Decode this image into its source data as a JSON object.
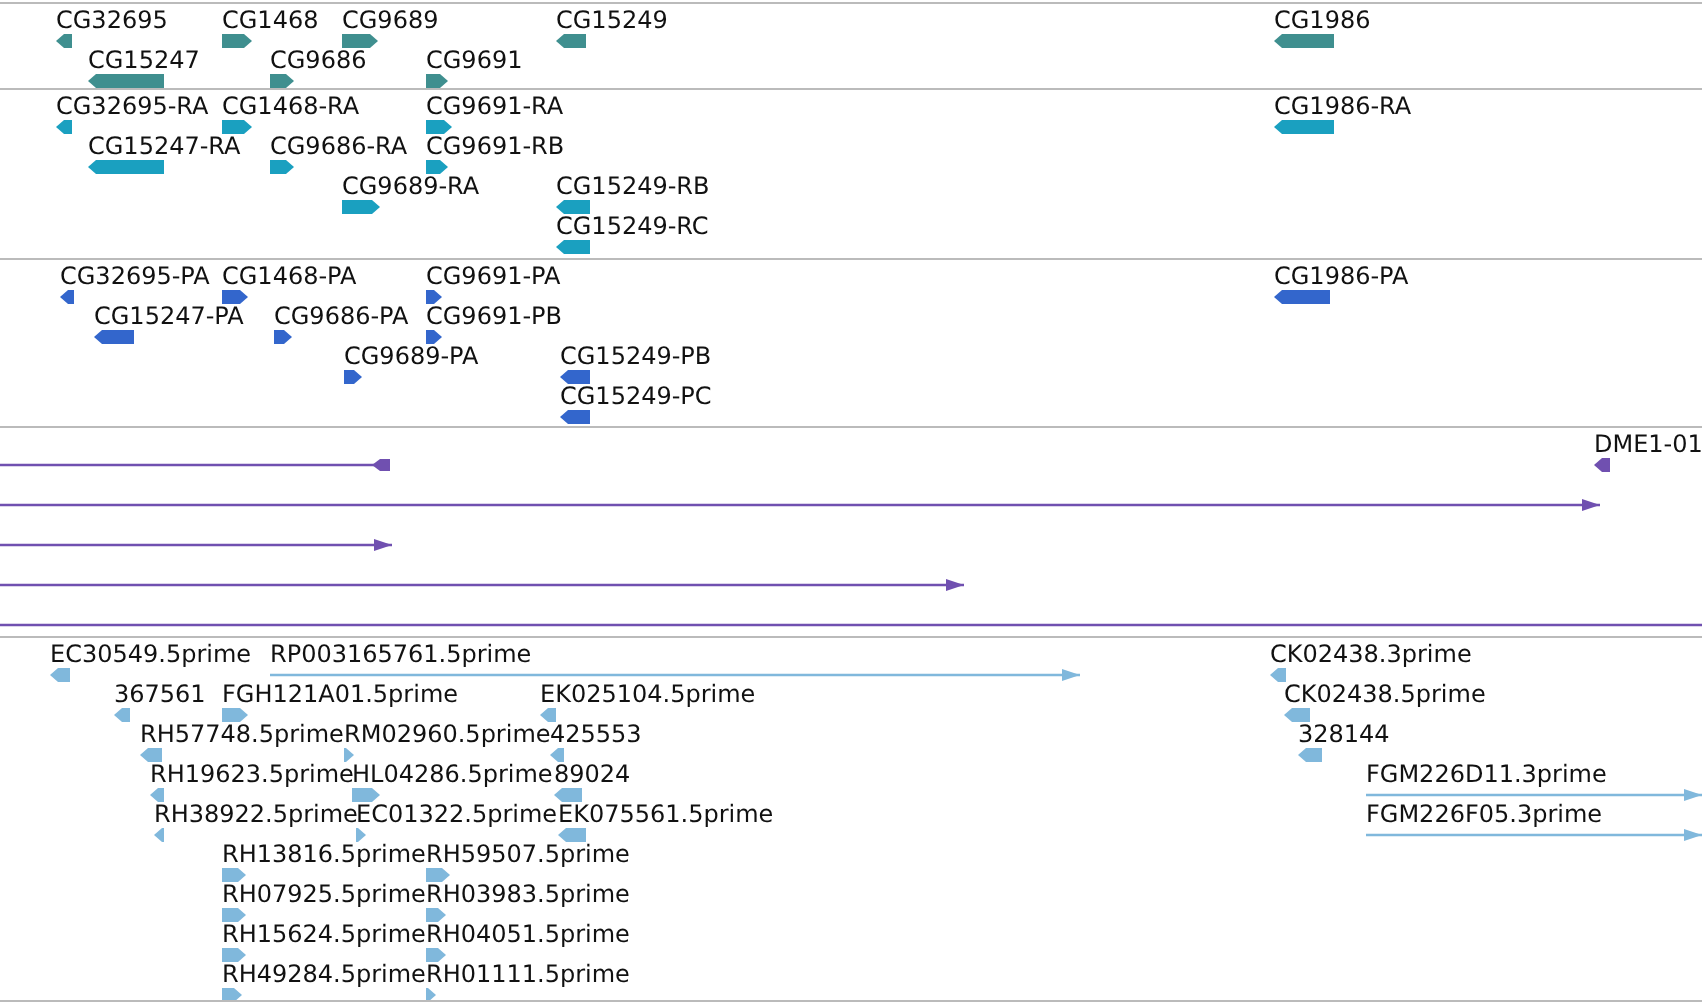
{
  "tracks": [
    {
      "color": "#3f8f8f",
      "features": [
        {
          "label": "CG32695",
          "reverse": true,
          "kind": "block"
        },
        {
          "label": "CG1468",
          "reverse": false,
          "kind": "block"
        },
        {
          "label": "CG9689",
          "reverse": false,
          "kind": "block"
        },
        {
          "label": "CG15249",
          "reverse": true,
          "kind": "block"
        },
        {
          "label": "CG1986",
          "reverse": true,
          "kind": "block"
        },
        {
          "label": "CG15247",
          "reverse": true,
          "kind": "block"
        },
        {
          "label": "CG9686",
          "reverse": false,
          "kind": "block"
        },
        {
          "label": "CG9691",
          "reverse": false,
          "kind": "block"
        }
      ]
    },
    {
      "color": "#1aa0c0",
      "features": [
        {
          "label": "CG32695-RA",
          "reverse": true,
          "kind": "block"
        },
        {
          "label": "CG1468-RA",
          "reverse": false,
          "kind": "block"
        },
        {
          "label": "CG9691-RA",
          "reverse": false,
          "kind": "block"
        },
        {
          "label": "CG1986-RA",
          "reverse": true,
          "kind": "block"
        },
        {
          "label": "CG15247-RA",
          "reverse": true,
          "kind": "block"
        },
        {
          "label": "CG9686-RA",
          "reverse": false,
          "kind": "block"
        },
        {
          "label": "CG9691-RB",
          "reverse": false,
          "kind": "block"
        },
        {
          "label": "CG9689-RA",
          "reverse": false,
          "kind": "block"
        },
        {
          "label": "CG15249-RB",
          "reverse": true,
          "kind": "block"
        },
        {
          "label": "CG15249-RC",
          "reverse": true,
          "kind": "block"
        }
      ]
    },
    {
      "color": "#3366cc",
      "features": [
        {
          "label": "CG32695-PA",
          "reverse": true,
          "kind": "block"
        },
        {
          "label": "CG1468-PA",
          "reverse": false,
          "kind": "block"
        },
        {
          "label": "CG9691-PA",
          "reverse": false,
          "kind": "block"
        },
        {
          "label": "CG1986-PA",
          "reverse": true,
          "kind": "block"
        },
        {
          "label": "CG15247-PA",
          "reverse": true,
          "kind": "block"
        },
        {
          "label": "CG9686-PA",
          "reverse": false,
          "kind": "block"
        },
        {
          "label": "CG9691-PB",
          "reverse": false,
          "kind": "block"
        },
        {
          "label": "CG9689-PA",
          "reverse": false,
          "kind": "block"
        },
        {
          "label": "CG15249-PB",
          "reverse": true,
          "kind": "block"
        },
        {
          "label": "CG15249-PC",
          "reverse": true,
          "kind": "block"
        }
      ]
    },
    {
      "color": "#7050b0",
      "features": [
        {
          "reverse": true,
          "kind": "arrowline"
        },
        {
          "label": "DME1-01",
          "reverse": true,
          "kind": "block"
        },
        {
          "reverse": false,
          "kind": "arrowline"
        },
        {
          "reverse": false,
          "kind": "arrowline"
        },
        {
          "reverse": false,
          "kind": "arrowline"
        },
        {
          "kind": "plainline"
        }
      ]
    },
    {
      "color": "#80b8dc",
      "features": [
        {
          "label": "EC30549.5prime",
          "reverse": true,
          "kind": "block"
        },
        {
          "label": "RP003165761.5prime",
          "reverse": false,
          "kind": "arrowline"
        },
        {
          "label": "CK02438.3prime",
          "reverse": true,
          "kind": "block"
        },
        {
          "label": "367561",
          "reverse": true,
          "kind": "block"
        },
        {
          "label": "FGH121A01.5prime",
          "reverse": false,
          "kind": "block"
        },
        {
          "label": "EK025104.5prime",
          "reverse": true,
          "kind": "block"
        },
        {
          "label": "CK02438.5prime",
          "reverse": true,
          "kind": "block"
        },
        {
          "label": "RH57748.5prime",
          "reverse": true,
          "kind": "block"
        },
        {
          "label": "RM02960.5prime",
          "reverse": false,
          "kind": "block"
        },
        {
          "label": "425553",
          "reverse": true,
          "kind": "block"
        },
        {
          "label": "328144",
          "reverse": true,
          "kind": "block"
        },
        {
          "label": "RH19623.5prime",
          "reverse": true,
          "kind": "block"
        },
        {
          "label": "HL04286.5prime",
          "reverse": false,
          "kind": "block"
        },
        {
          "label": "89024",
          "reverse": true,
          "kind": "block"
        },
        {
          "label": "FGM226D11.3prime",
          "reverse": false,
          "kind": "arrowline"
        },
        {
          "label": "RH38922.5prime",
          "reverse": true,
          "kind": "block"
        },
        {
          "label": "EC01322.5prime",
          "reverse": false,
          "kind": "block"
        },
        {
          "label": "EK075561.5prime",
          "reverse": true,
          "kind": "block"
        },
        {
          "label": "FGM226F05.3prime",
          "reverse": false,
          "kind": "arrowline"
        },
        {
          "label": "RH13816.5prime",
          "reverse": false,
          "kind": "block"
        },
        {
          "label": "RH59507.5prime",
          "reverse": false,
          "kind": "block"
        },
        {
          "label": "RH07925.5prime",
          "reverse": false,
          "kind": "block"
        },
        {
          "label": "RH03983.5prime",
          "reverse": false,
          "kind": "block"
        },
        {
          "label": "RH15624.5prime",
          "reverse": false,
          "kind": "block"
        },
        {
          "label": "RH04051.5prime",
          "reverse": false,
          "kind": "block"
        },
        {
          "label": "RH49284.5prime",
          "reverse": false,
          "kind": "block"
        },
        {
          "label": "RH01111.5prime",
          "reverse": false,
          "kind": "block"
        }
      ]
    }
  ]
}
